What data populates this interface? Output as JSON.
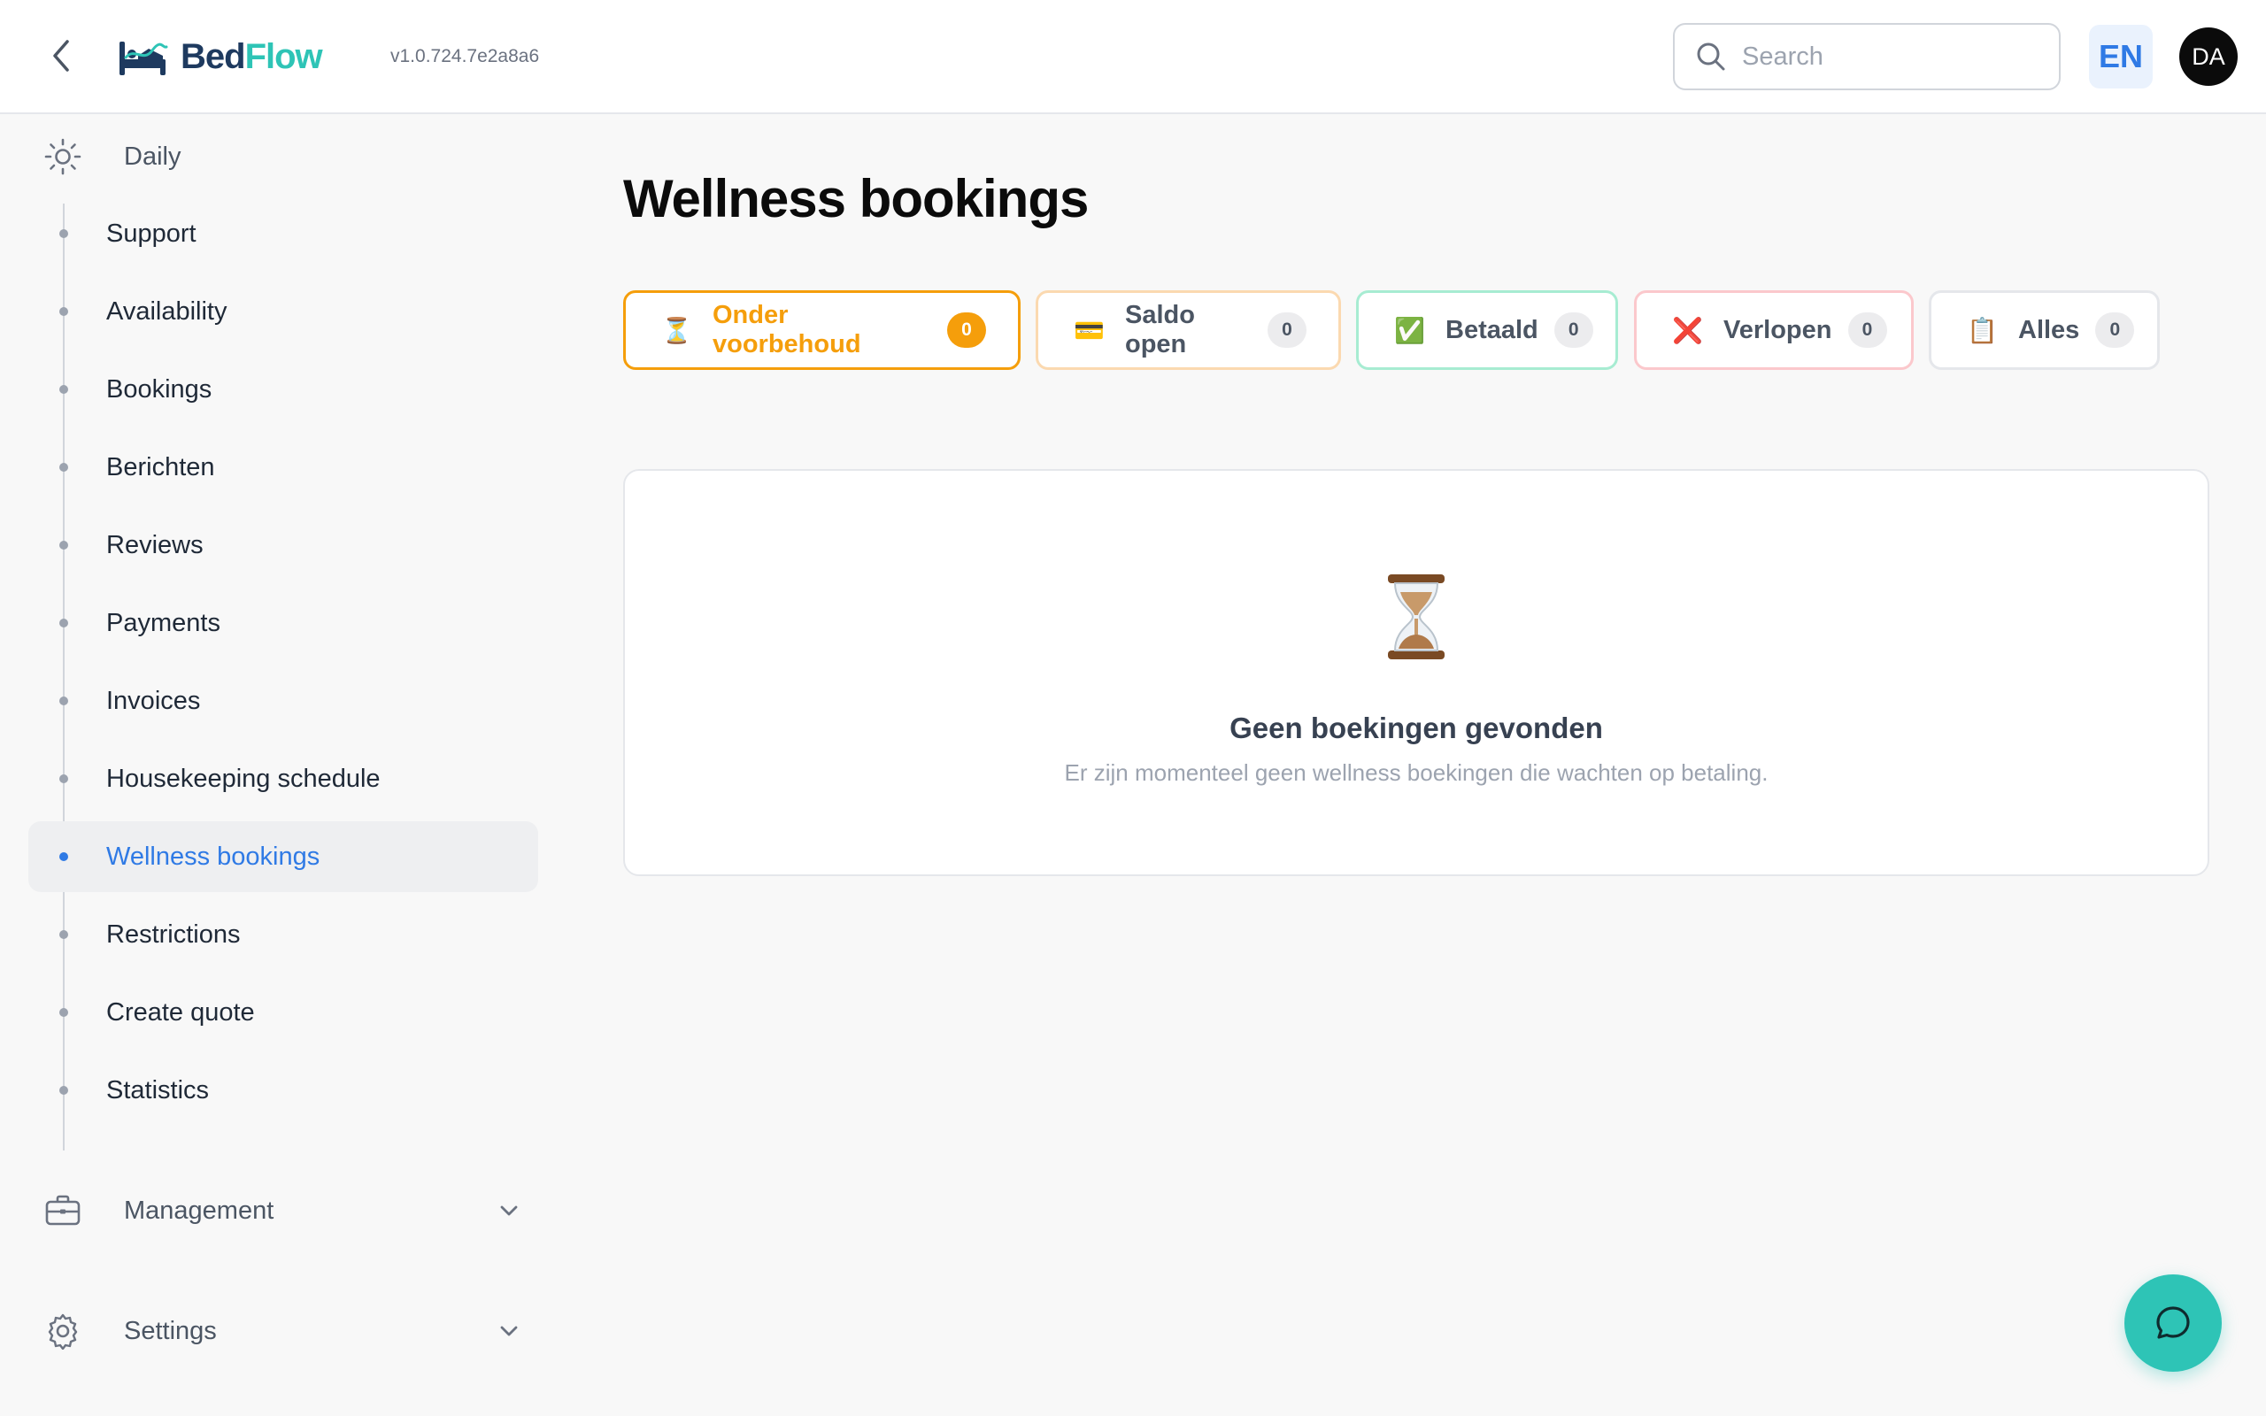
{
  "header": {
    "logo_part1": "Bed",
    "logo_part2": "Flow",
    "version": "v1.0.724.7e2a8a6",
    "search_placeholder": "Search",
    "language": "EN",
    "user_initials": "DA"
  },
  "sidebar": {
    "daily_label": "Daily",
    "items": [
      {
        "label": "Support"
      },
      {
        "label": "Availability"
      },
      {
        "label": "Bookings"
      },
      {
        "label": "Berichten"
      },
      {
        "label": "Reviews"
      },
      {
        "label": "Payments"
      },
      {
        "label": "Invoices"
      },
      {
        "label": "Housekeeping schedule"
      },
      {
        "label": "Wellness bookings",
        "active": true
      },
      {
        "label": "Restrictions"
      },
      {
        "label": "Create quote"
      },
      {
        "label": "Statistics"
      }
    ],
    "management_label": "Management",
    "settings_label": "Settings"
  },
  "main": {
    "title": "Wellness bookings",
    "tabs": [
      {
        "icon": "⏳",
        "label": "Onder voorbehoud",
        "count": "0",
        "active": true,
        "color": "#f59e0b"
      },
      {
        "icon": "💳",
        "label": "Saldo open",
        "count": "0",
        "color": "#fbd9b0"
      },
      {
        "icon": "✅",
        "label": "Betaald",
        "count": "0",
        "color": "#a7ecd2"
      },
      {
        "icon": "❌",
        "label": "Verlopen",
        "count": "0",
        "color": "#fbc8cc"
      },
      {
        "icon": "📋",
        "label": "Alles",
        "count": "0",
        "color": "#e5e7eb"
      }
    ],
    "empty": {
      "icon": "hourglass-icon",
      "title": "Geen boekingen gevonden",
      "subtitle": "Er zijn momenteel geen wellness boekingen die wachten op betaling."
    }
  },
  "colors": {
    "accent_blue": "#2f7ae5",
    "brand_teal": "#2ec4b6",
    "brand_navy": "#1e3a5f",
    "pending_orange": "#f59e0b"
  }
}
